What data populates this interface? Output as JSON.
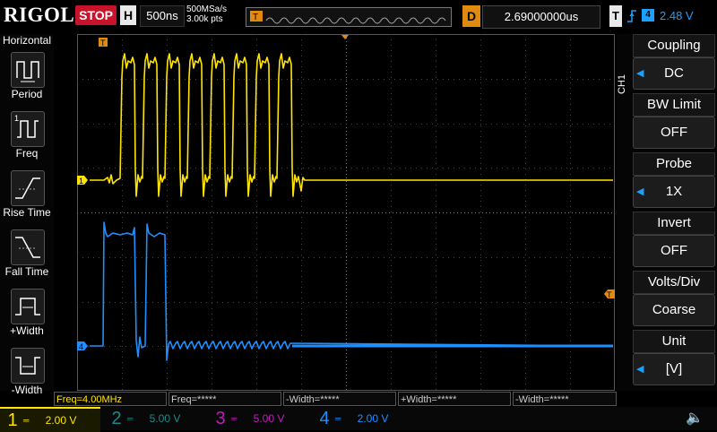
{
  "top": {
    "brand": "RIGOL",
    "run_state": "STOP",
    "h_label": "H",
    "timebase": "500ns",
    "sample_rate": "500MSa/s",
    "mem_depth": "3.00k pts",
    "delay_label": "D",
    "delay_value": "2.69000000us",
    "trig_label": "T",
    "trig_source": "4",
    "trig_level": "2.48 V"
  },
  "left_menu": {
    "title": "Horizontal",
    "items": [
      {
        "label": "Period",
        "icon": "period-icon"
      },
      {
        "label": "Freq",
        "icon": "freq-icon"
      },
      {
        "label": "Rise Time",
        "icon": "rise-time-icon"
      },
      {
        "label": "Fall Time",
        "icon": "fall-time-icon"
      },
      {
        "label": "+Width",
        "icon": "pos-width-icon"
      },
      {
        "label": "-Width",
        "icon": "neg-width-icon"
      }
    ]
  },
  "right_menu": {
    "channel": "CH1",
    "items": [
      {
        "title": "Coupling",
        "value": "DC"
      },
      {
        "title": "BW Limit",
        "value": "OFF"
      },
      {
        "title": "Probe",
        "value": "1X"
      },
      {
        "title": "Invert",
        "value": "OFF"
      },
      {
        "title": "Volts/Div",
        "value": "Coarse"
      },
      {
        "title": "Unit",
        "value": "[V]"
      }
    ]
  },
  "grid_markers": {
    "trigger_pos": "T",
    "ch1_marker": "1",
    "ch4_marker": "4",
    "trig_level_marker": "T"
  },
  "measurements": [
    {
      "text": "Freq=4.00MHz"
    },
    {
      "text": "Freq=*****"
    },
    {
      "text": "-Width=*****"
    },
    {
      "text": "+Width=*****"
    },
    {
      "text": "-Width=*****"
    }
  ],
  "channels": [
    {
      "num": "1",
      "scale": "2.00 V",
      "color": "#ffe400",
      "active": true
    },
    {
      "num": "2",
      "scale": "5.00 V",
      "color": "#1a8a8a",
      "active": false
    },
    {
      "num": "3",
      "scale": "5.00 V",
      "color": "#c21bbd",
      "active": false
    },
    {
      "num": "4",
      "scale": "2.00 V",
      "color": "#1e8fff",
      "active": true
    }
  ],
  "colors": {
    "ch1": "#ffe400",
    "ch4": "#1e8fff",
    "stop": "#c8142a",
    "delay": "#e08a10"
  }
}
